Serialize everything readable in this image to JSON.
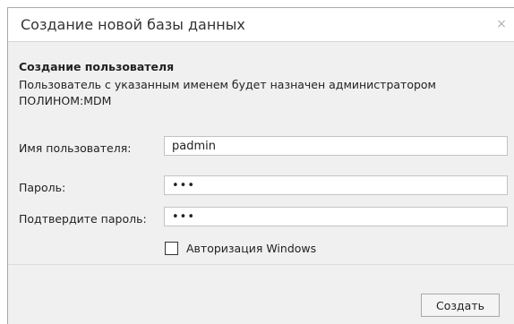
{
  "dialog": {
    "title": "Создание новой базы данных",
    "close_glyph": "×"
  },
  "section": {
    "title": "Создание пользователя",
    "description": "Пользователь с указанным именем будет назначен администратором ПОЛИНОМ:MDM"
  },
  "form": {
    "username": {
      "label": "Имя пользователя:",
      "value": "padmin"
    },
    "password": {
      "label": "Пароль:",
      "value": "•••"
    },
    "confirm_password": {
      "label": "Подтвердите пароль:",
      "value": "•••"
    },
    "windows_auth": {
      "label": "Авторизация Windows",
      "checked": false
    }
  },
  "footer": {
    "create_label": "Создать"
  }
}
